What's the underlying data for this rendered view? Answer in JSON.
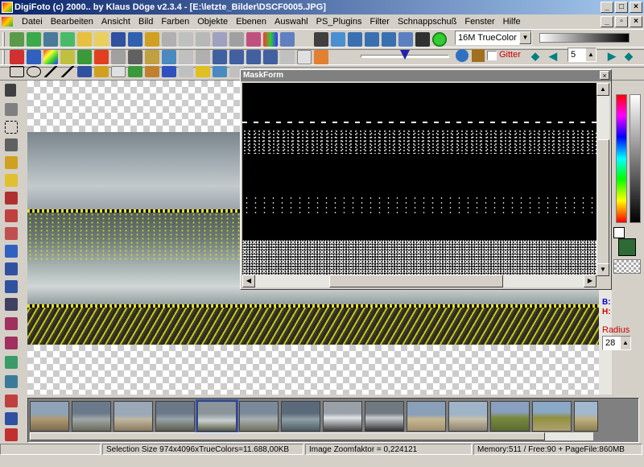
{
  "window": {
    "title": "DigiFoto (c) 2000.. by Klaus Döge v2.3.4 - [E:\\letzte_Bilder\\DSCF0005.JPG]"
  },
  "menu": {
    "items": [
      "Datei",
      "Bearbeiten",
      "Ansicht",
      "Bild",
      "Farben",
      "Objekte",
      "Ebenen",
      "Auswahl",
      "PS_Plugins",
      "Filter",
      "Schnappschuß",
      "Fenster",
      "Hilfe"
    ]
  },
  "toolbar": {
    "color_mode": "16M TrueColor",
    "grid_label": "Gitter",
    "step_value": "5"
  },
  "maskform": {
    "title": "MaskForm"
  },
  "right_panel": {
    "b_label": "B:",
    "h_label": "H:",
    "radius_label": "Radius",
    "radius_value": "28"
  },
  "colors": {
    "foreground": "#2d6a35",
    "background": "#ffffff",
    "title_active": "#0a246a",
    "accent_red": "#cc0000"
  },
  "thumbnails": {
    "count": 14,
    "selected_index": 4
  },
  "status": {
    "selection": "Selection Size 974x4096xTrueColors=11.688,00KB",
    "zoom": "Image Zoomfaktor = 0,224121",
    "memory": "Memory:511 / Free:90 + PageFile:860MB"
  }
}
